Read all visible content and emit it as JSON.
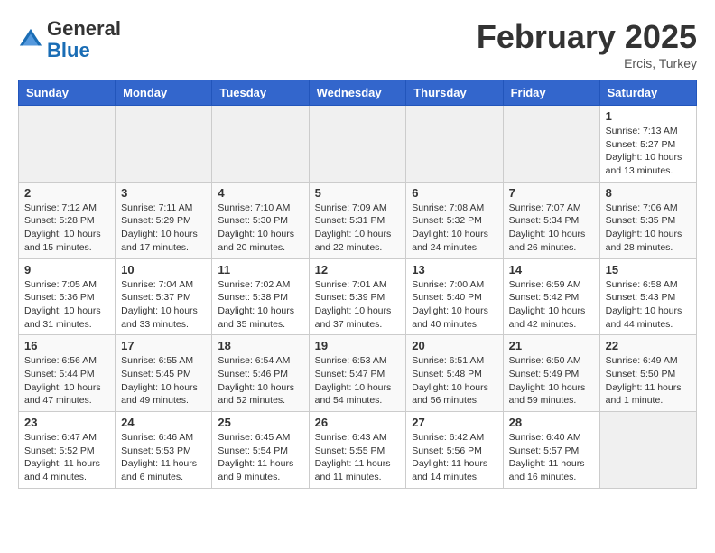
{
  "header": {
    "logo_general": "General",
    "logo_blue": "Blue",
    "month_title": "February 2025",
    "location": "Ercis, Turkey"
  },
  "days_of_week": [
    "Sunday",
    "Monday",
    "Tuesday",
    "Wednesday",
    "Thursday",
    "Friday",
    "Saturday"
  ],
  "weeks": [
    [
      {
        "day": "",
        "info": ""
      },
      {
        "day": "",
        "info": ""
      },
      {
        "day": "",
        "info": ""
      },
      {
        "day": "",
        "info": ""
      },
      {
        "day": "",
        "info": ""
      },
      {
        "day": "",
        "info": ""
      },
      {
        "day": "1",
        "info": "Sunrise: 7:13 AM\nSunset: 5:27 PM\nDaylight: 10 hours\nand 13 minutes."
      }
    ],
    [
      {
        "day": "2",
        "info": "Sunrise: 7:12 AM\nSunset: 5:28 PM\nDaylight: 10 hours\nand 15 minutes."
      },
      {
        "day": "3",
        "info": "Sunrise: 7:11 AM\nSunset: 5:29 PM\nDaylight: 10 hours\nand 17 minutes."
      },
      {
        "day": "4",
        "info": "Sunrise: 7:10 AM\nSunset: 5:30 PM\nDaylight: 10 hours\nand 20 minutes."
      },
      {
        "day": "5",
        "info": "Sunrise: 7:09 AM\nSunset: 5:31 PM\nDaylight: 10 hours\nand 22 minutes."
      },
      {
        "day": "6",
        "info": "Sunrise: 7:08 AM\nSunset: 5:32 PM\nDaylight: 10 hours\nand 24 minutes."
      },
      {
        "day": "7",
        "info": "Sunrise: 7:07 AM\nSunset: 5:34 PM\nDaylight: 10 hours\nand 26 minutes."
      },
      {
        "day": "8",
        "info": "Sunrise: 7:06 AM\nSunset: 5:35 PM\nDaylight: 10 hours\nand 28 minutes."
      }
    ],
    [
      {
        "day": "9",
        "info": "Sunrise: 7:05 AM\nSunset: 5:36 PM\nDaylight: 10 hours\nand 31 minutes."
      },
      {
        "day": "10",
        "info": "Sunrise: 7:04 AM\nSunset: 5:37 PM\nDaylight: 10 hours\nand 33 minutes."
      },
      {
        "day": "11",
        "info": "Sunrise: 7:02 AM\nSunset: 5:38 PM\nDaylight: 10 hours\nand 35 minutes."
      },
      {
        "day": "12",
        "info": "Sunrise: 7:01 AM\nSunset: 5:39 PM\nDaylight: 10 hours\nand 37 minutes."
      },
      {
        "day": "13",
        "info": "Sunrise: 7:00 AM\nSunset: 5:40 PM\nDaylight: 10 hours\nand 40 minutes."
      },
      {
        "day": "14",
        "info": "Sunrise: 6:59 AM\nSunset: 5:42 PM\nDaylight: 10 hours\nand 42 minutes."
      },
      {
        "day": "15",
        "info": "Sunrise: 6:58 AM\nSunset: 5:43 PM\nDaylight: 10 hours\nand 44 minutes."
      }
    ],
    [
      {
        "day": "16",
        "info": "Sunrise: 6:56 AM\nSunset: 5:44 PM\nDaylight: 10 hours\nand 47 minutes."
      },
      {
        "day": "17",
        "info": "Sunrise: 6:55 AM\nSunset: 5:45 PM\nDaylight: 10 hours\nand 49 minutes."
      },
      {
        "day": "18",
        "info": "Sunrise: 6:54 AM\nSunset: 5:46 PM\nDaylight: 10 hours\nand 52 minutes."
      },
      {
        "day": "19",
        "info": "Sunrise: 6:53 AM\nSunset: 5:47 PM\nDaylight: 10 hours\nand 54 minutes."
      },
      {
        "day": "20",
        "info": "Sunrise: 6:51 AM\nSunset: 5:48 PM\nDaylight: 10 hours\nand 56 minutes."
      },
      {
        "day": "21",
        "info": "Sunrise: 6:50 AM\nSunset: 5:49 PM\nDaylight: 10 hours\nand 59 minutes."
      },
      {
        "day": "22",
        "info": "Sunrise: 6:49 AM\nSunset: 5:50 PM\nDaylight: 11 hours\nand 1 minute."
      }
    ],
    [
      {
        "day": "23",
        "info": "Sunrise: 6:47 AM\nSunset: 5:52 PM\nDaylight: 11 hours\nand 4 minutes."
      },
      {
        "day": "24",
        "info": "Sunrise: 6:46 AM\nSunset: 5:53 PM\nDaylight: 11 hours\nand 6 minutes."
      },
      {
        "day": "25",
        "info": "Sunrise: 6:45 AM\nSunset: 5:54 PM\nDaylight: 11 hours\nand 9 minutes."
      },
      {
        "day": "26",
        "info": "Sunrise: 6:43 AM\nSunset: 5:55 PM\nDaylight: 11 hours\nand 11 minutes."
      },
      {
        "day": "27",
        "info": "Sunrise: 6:42 AM\nSunset: 5:56 PM\nDaylight: 11 hours\nand 14 minutes."
      },
      {
        "day": "28",
        "info": "Sunrise: 6:40 AM\nSunset: 5:57 PM\nDaylight: 11 hours\nand 16 minutes."
      },
      {
        "day": "",
        "info": ""
      }
    ]
  ]
}
